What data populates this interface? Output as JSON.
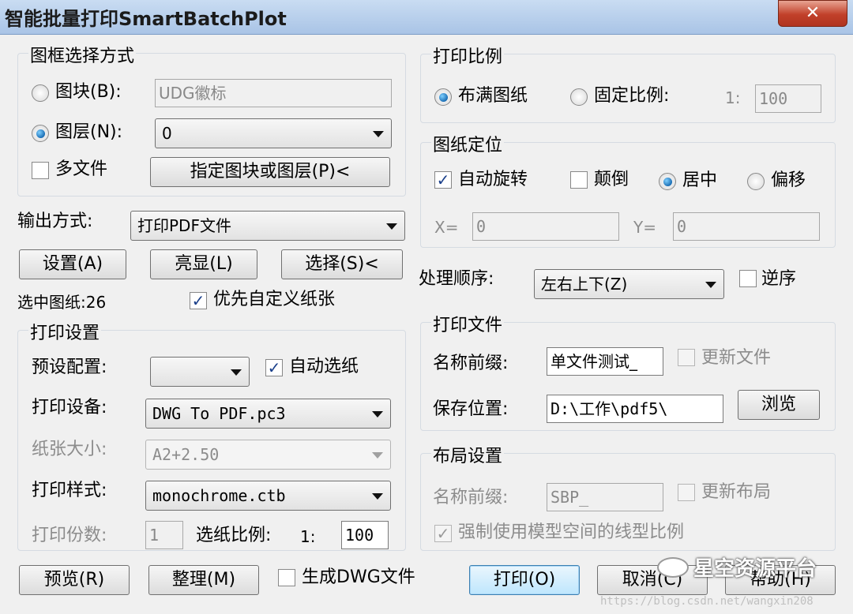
{
  "window": {
    "title": "智能批量打印SmartBatchPlot",
    "close": "✕"
  },
  "frame_select": {
    "title": "图框选择方式",
    "block_label": "图块(B):",
    "block_value": "UDG徽标",
    "layer_label": "图层(N):",
    "layer_value": "0",
    "multi_file_label": "多文件",
    "pick_button": "指定图块或图层(P)<"
  },
  "output": {
    "label": "输出方式:",
    "value": "打印PDF文件",
    "settings_button": "设置(A)",
    "highlight_button": "亮显(L)",
    "select_button": "选择(S)<",
    "selected_count": "选中图纸:26",
    "prefer_custom_paper": "优先自定义纸张"
  },
  "print_settings": {
    "title": "打印设置",
    "preset_label": "预设配置:",
    "preset_value": "",
    "auto_paper_label": "自动选纸",
    "device_label": "打印设备:",
    "device_value": "DWG To PDF.pc3",
    "paper_size_label": "纸张大小:",
    "paper_size_value": "A2+2.50",
    "style_label": "打印样式:",
    "style_value": "monochrome.ctb",
    "copies_label": "打印份数:",
    "copies_value": "1",
    "scale_label": "选纸比例:",
    "scale_prefix": "1:",
    "scale_value": "100"
  },
  "print_scale": {
    "title": "打印比例",
    "fit_label": "布满图纸",
    "fixed_label": "固定比例:",
    "ratio_prefix": "1:",
    "ratio_value": "100"
  },
  "paper_position": {
    "title": "图纸定位",
    "auto_rotate": "自动旋转",
    "upside_down": "颠倒",
    "center": "居中",
    "offset": "偏移",
    "x_label": "X=",
    "x_value": "0",
    "y_label": "Y=",
    "y_value": "0"
  },
  "order": {
    "label": "处理顺序:",
    "value": "左右上下(Z)",
    "reverse": "逆序"
  },
  "print_file": {
    "title": "打印文件",
    "prefix_label": "名称前缀:",
    "prefix_value": "单文件测试_",
    "update_file": "更新文件",
    "save_label": "保存位置:",
    "save_value": "D:\\工作\\pdf5\\",
    "browse_button": "浏览"
  },
  "layout_settings": {
    "title": "布局设置",
    "prefix_label": "名称前缀:",
    "prefix_value": "SBP_",
    "update_layout": "更新布局",
    "force_model_ltscale": "强制使用模型空间的线型比例"
  },
  "bottom": {
    "preview_button": "预览(R)",
    "organize_button": "整理(M)",
    "gen_dwg": "生成DWG文件",
    "print_button": "打印(O)",
    "cancel_button": "取消(C)",
    "help_button": "帮助(H)"
  },
  "watermark": {
    "text": "星空资源平台",
    "url": "https://blog.csdn.net/wangxin208"
  }
}
